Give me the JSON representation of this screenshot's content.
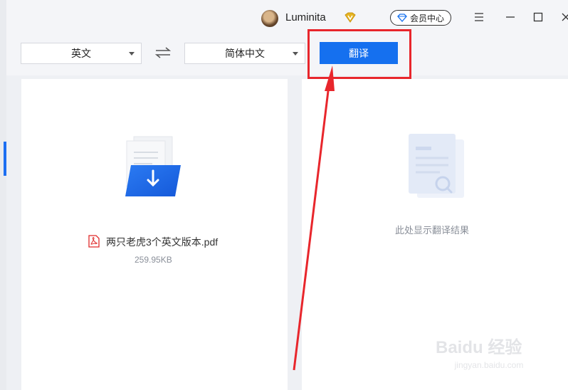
{
  "header": {
    "username": "Luminita",
    "member_label": "会员中心",
    "icons": [
      "avatar",
      "vip-badge-icon",
      "diamond-icon",
      "menu-icon",
      "minimize-icon",
      "maximize-icon",
      "close-icon"
    ]
  },
  "toolbar": {
    "source_lang": "英文",
    "target_lang": "简体中文",
    "translate_label": "翻译"
  },
  "left_panel": {
    "file_name": "两只老虎3个英文版本.pdf",
    "file_size": "259.95KB"
  },
  "right_panel": {
    "placeholder": "此处显示翻译结果"
  },
  "colors": {
    "accent": "#1570ef",
    "highlight": "#e8262c",
    "background": "#eef0f4"
  },
  "watermark": {
    "line1": "Baidu 经验",
    "line2": "jingyan.baidu.com"
  }
}
